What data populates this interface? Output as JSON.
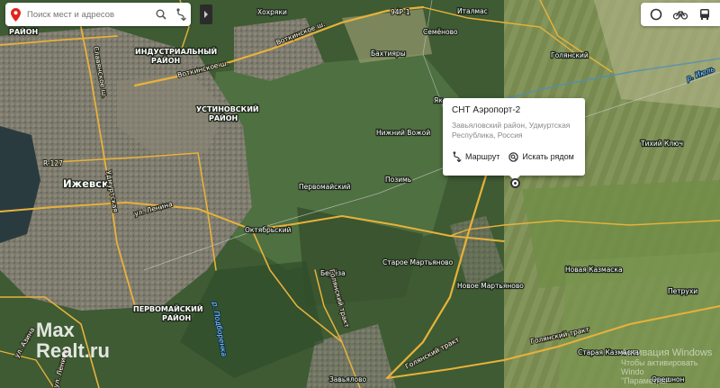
{
  "search": {
    "placeholder": "Поиск мест и адресов"
  },
  "map": {
    "labels": {
      "raion_top": "РАЙОН",
      "industrialny": "ИНДУСТРИАЛЬНЫЙ",
      "industrialny_2": "РАЙОН",
      "ustinovsky": "УСТИНОВСКИЙ",
      "ustinovsky_2": "РАЙОН",
      "pervomaisky_r": "ПЕРВОМАЙСКИЙ",
      "pervomaisky_r2": "РАЙОН",
      "izhevsk": "Ижевск",
      "khokhryaki": "Хохряки",
      "italmas": "Италмас",
      "semenovo": "Семёново",
      "bakhtiyary": "Бахтияры",
      "golyanskoy": "Голянский",
      "nizhny_vozhoy": "Нижний Вожой",
      "pervomaisky": "Первомайский",
      "pozim": "Позимь",
      "oktyabrsky": "Октябрьский",
      "bereza": "Берёза",
      "staroe_martyanovo": "Старое Мартьяново",
      "novoe_martyanovo": "Новое Мартьяново",
      "novaya_kazmaska": "Новая Казмаска",
      "petrukhi": "Петрухи",
      "tikhy_klyuch": "Тихий Ключ",
      "staraya_kazmaska": "Старая Казмаска",
      "oryashon": "Орешнон",
      "zavyalovo": "Завьялово",
      "ya": "Як"
    },
    "roads": {
      "votkinskoe_sh": "Воткинское ш.",
      "votkinskoe_sh2": "Воткинское ш.",
      "ul_lenina": "ул. Ленина",
      "udmurtskaya": "Удмуртская",
      "slavyanskoe_sh": "Славянское ш.",
      "golyansky_trakt": "Голянский тракт",
      "golyansky_trakt2": "Голянский тракт",
      "golyansky_trakt3": "Голянский тракт",
      "ul_azina": "ул. Азина",
      "ul_lenina2": "ул. Ленина",
      "r_izh": "R-127",
      "r_94": "94Р-1",
      "r_iul": "р. Июль",
      "r_podborenka": "р. Подборенка"
    }
  },
  "popup": {
    "title": "СНТ Аэропорт-2",
    "address": "Завьяловский район, Удмуртская Республика, Россия",
    "route_label": "Маршрут",
    "nearby_label": "Искать рядом"
  },
  "watermark": {
    "line1": "Max",
    "line2": "Realt.ru"
  },
  "windows_activation": {
    "line1": "Активация Windows",
    "line2": "Чтобы активировать Windo",
    "line3": "\"Параметры\""
  },
  "colors": {
    "road": "#e8b23a",
    "pin": "#e0251b"
  }
}
